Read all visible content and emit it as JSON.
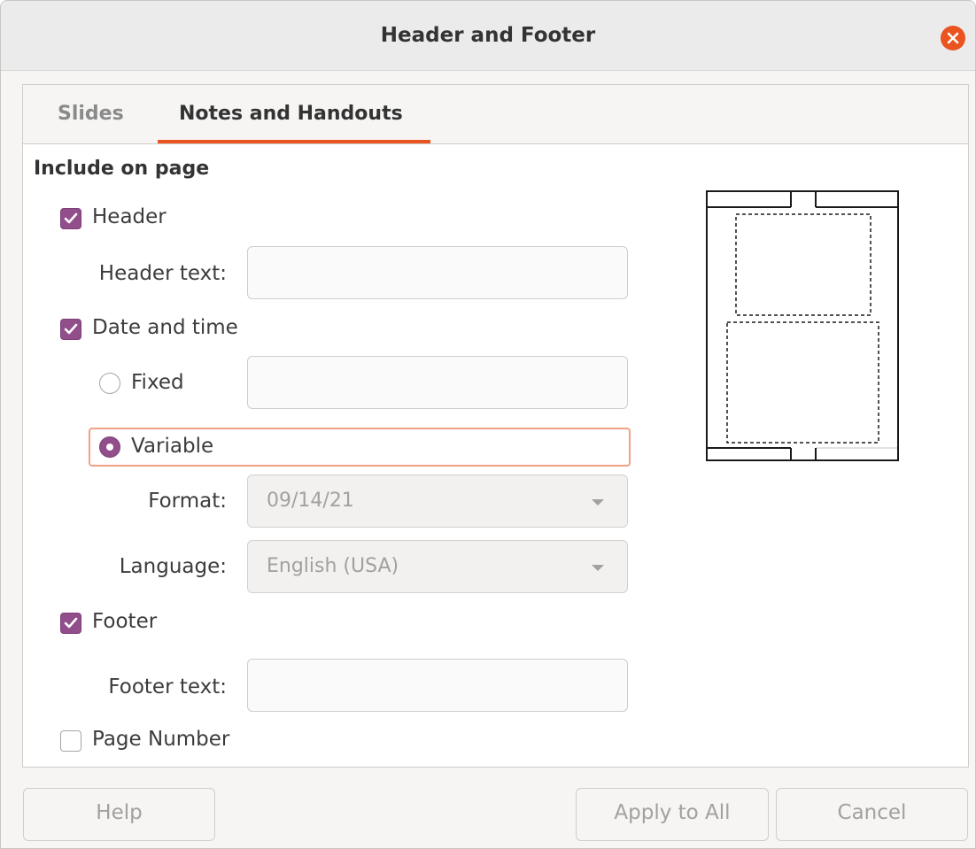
{
  "window": {
    "title": "Header and Footer",
    "close_icon": "close-icon"
  },
  "tabs": [
    {
      "label": "Slides",
      "selected": false
    },
    {
      "label": "Notes and Handouts",
      "selected": true
    }
  ],
  "section": {
    "title": "Include on page"
  },
  "header": {
    "checkbox_label": "Header",
    "checked": true,
    "text_label": "Header text:",
    "text_value": ""
  },
  "date_time": {
    "checkbox_label": "Date and time",
    "checked": true,
    "fixed_label": "Fixed",
    "fixed_selected": false,
    "fixed_value": "",
    "variable_label": "Variable",
    "variable_selected": true,
    "format_label": "Format:",
    "format_value": "09/14/21",
    "language_label": "Language:",
    "language_value": "English (USA)"
  },
  "footer": {
    "checkbox_label": "Footer",
    "checked": true,
    "text_label": "Footer text:",
    "text_value": ""
  },
  "page_number": {
    "checkbox_label": "Page Number",
    "checked": false
  },
  "buttons": {
    "help": "Help",
    "apply_all": "Apply to All",
    "cancel": "Cancel"
  },
  "colors": {
    "accent": "#e95420",
    "check": "#924d8b",
    "focus": "#f1a184"
  }
}
